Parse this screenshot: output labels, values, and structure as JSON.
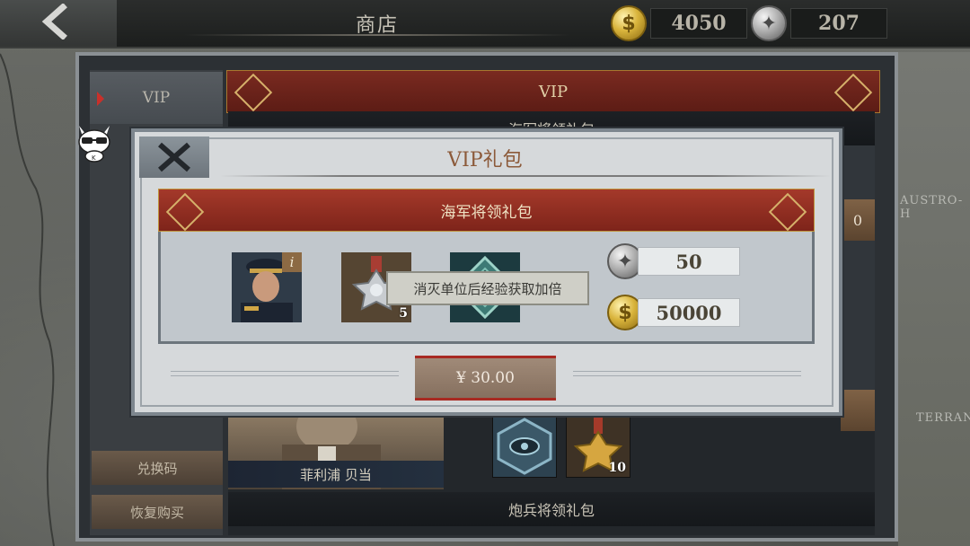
{
  "top_bar": {
    "title": "商店",
    "gold_amount": "4050",
    "silver_amount": "207"
  },
  "sidebar": {
    "tabs": [
      {
        "label": "VIP"
      }
    ],
    "redeem_button": "兑换码",
    "restore_button": "恢复购买"
  },
  "content": {
    "vip_header": "VIP",
    "row1_title": "海军将领礼包",
    "officer_name": "菲利浦 贝当",
    "artillery_pack_title": "炮兵将领礼包",
    "medal_count": "10",
    "side_stub_1": "0",
    "side_stub_2": "",
    "map_label_1": "AUSTRO-H",
    "map_label_2": "TERRANE"
  },
  "modal": {
    "title": "VIP礼包",
    "pack_name": "海军将领礼包",
    "rewards": [
      {
        "name": "admiral-portrait",
        "info": "i"
      },
      {
        "name": "silver-medal",
        "count": "5"
      },
      {
        "name": "navy-emblem"
      }
    ],
    "tooltip": "消灭单位后经验获取加倍",
    "silver_reward": "50",
    "gold_reward": "50000",
    "price": "¥ 30.00"
  },
  "colors": {
    "header_red": "#7e241a",
    "gold_trim": "#d5b06a",
    "price_border": "#a82a22"
  }
}
